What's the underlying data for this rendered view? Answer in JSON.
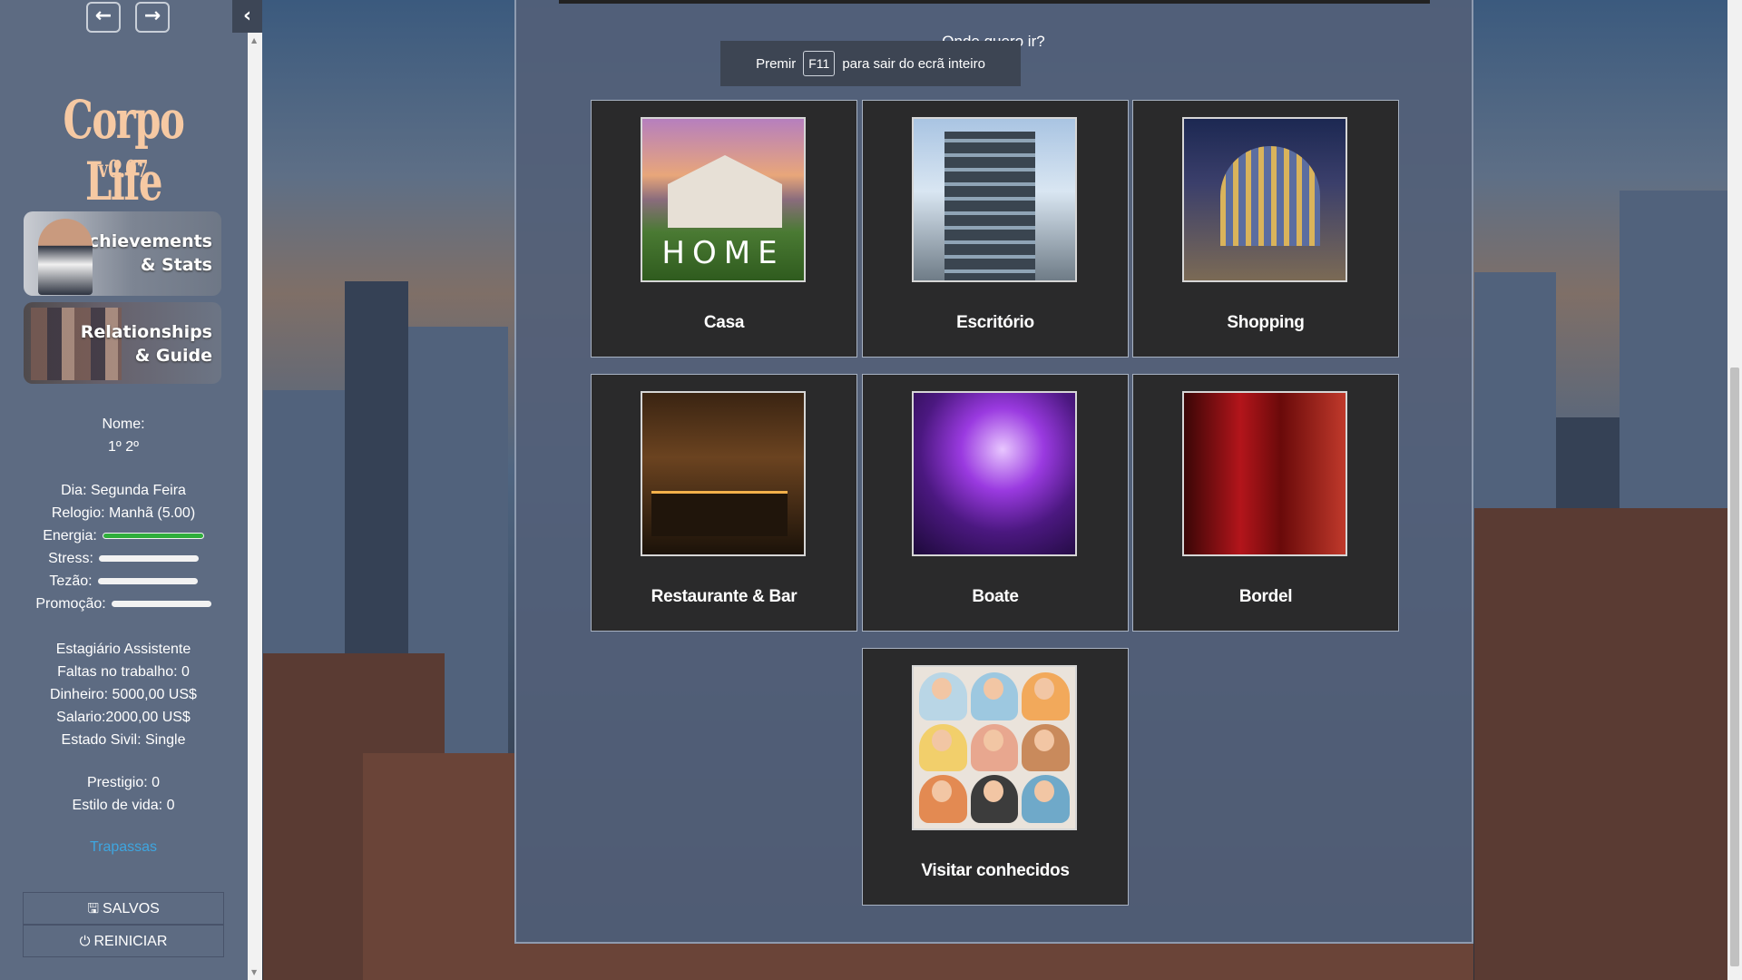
{
  "sidebar": {
    "game_title": "Corpo Life",
    "version": "v0.07",
    "banners": {
      "achievements": "Achievements & Stats",
      "achievements_line1": "Achievements",
      "achievements_line2": "& Stats",
      "relationships_line1": "Relationships",
      "relationships_line2": "& Guide"
    },
    "name_label": "Nome:",
    "name_value": "1º 2º",
    "day": "Dia: Segunda Feira",
    "clock": "Relogio: Manhã (5.00)",
    "bars": [
      {
        "label": "Energia:",
        "level": 1.0,
        "color": "#2fae3b"
      },
      {
        "label": "Stress:",
        "level": 0.0
      },
      {
        "label": "Tezão:",
        "level": 0.0
      },
      {
        "label": "Promoção:",
        "level": 0.0
      }
    ],
    "career": "Estagiário Assistente",
    "absences": "Faltas no trabalho: 0",
    "money": "Dinheiro: 5000,00 US$",
    "salary": "Salario:2000,00 US$",
    "civil_status": "Estado Sivil: Single",
    "prestige": "Prestigio: 0",
    "lifestyle": "Estilo de vida: 0",
    "cheats_link": "Trapassas",
    "saves_button": "SALVOS",
    "restart_button": "REINICIAR"
  },
  "main": {
    "question": "Onde quero ir?",
    "fullscreen_note": {
      "pre": "Premir",
      "key": "F11",
      "post": "para sair do ecrã inteiro"
    },
    "locations": [
      {
        "label": "Casa",
        "thumb_text": "HOME"
      },
      {
        "label": "Escritório"
      },
      {
        "label": "Shopping"
      },
      {
        "label": "Restaurante & Bar"
      },
      {
        "label": "Boate"
      },
      {
        "label": "Bordel"
      },
      {
        "label": "Visitar conhecidos"
      }
    ]
  },
  "icons": {
    "back": "arrow-left-icon",
    "forward": "arrow-right-icon",
    "collapse": "chevron-left-icon",
    "saves": "floppy-disk-icon",
    "restart": "power-icon"
  },
  "colors": {
    "sidebar_bg": "#5d6b82",
    "panel_bg": "#526078",
    "card_bg": "#2a2a2b",
    "link": "#3ea6e0",
    "energy": "#2fae3b",
    "logo": "#f6c9a3"
  }
}
